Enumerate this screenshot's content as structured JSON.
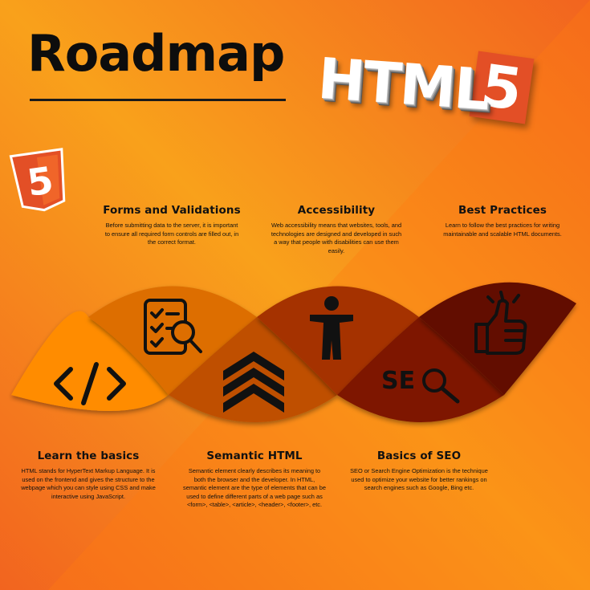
{
  "title": "Roadmap",
  "logo": {
    "text": "HTML",
    "five": "5",
    "shield_five": "5"
  },
  "colors": {
    "bg_light": "#f9a11b",
    "bg_dark": "#f2641f",
    "seg_learn": "#ff8c00",
    "seg_forms": "#dd6e00",
    "seg_semantic": "#bf4f00",
    "seg_access": "#a53200",
    "seg_seo": "#7e1800",
    "seg_best": "#620b00",
    "html5_orange": "#e34f26"
  },
  "topics": [
    {
      "name": "Learn the basics",
      "icon": "code-brackets-icon",
      "description": "HTML stands for HyperText Markup Language. It is used on the frontend and gives the structure to the webpage which you can style using CSS and make interactive using JavaScript."
    },
    {
      "name": "Forms and Validations",
      "icon": "checklist-search-icon",
      "description": "Before submitting data to the server, it is important to ensure all required form controls are filled out, in the correct format."
    },
    {
      "name": "Semantic HTML",
      "icon": "chevrons-up-icon",
      "description": "Semantic element clearly describes its meaning to both the browser and the developer. In HTML, semantic element are the type of elements that can be used to define different parts of a web page such as <form>, <table>, <article>, <header>, <footer>, etc."
    },
    {
      "name": "Accessibility",
      "icon": "accessibility-person-icon",
      "description": "Web accessibility means that websites, tools, and technologies are designed and developed in such a way that people with disabilities can use them easily."
    },
    {
      "name": "Basics of SEO",
      "icon": "seo-search-icon",
      "icon_text": "SE",
      "description": "SEO or Search Engine Optimization is the technique used to optimize your website for better rankings on search engines such as Google, Bing etc."
    },
    {
      "name": "Best Practices",
      "icon": "thumbs-up-icon",
      "description": "Learn to follow the best practices for writing maintainable and scalable HTML documents."
    }
  ]
}
